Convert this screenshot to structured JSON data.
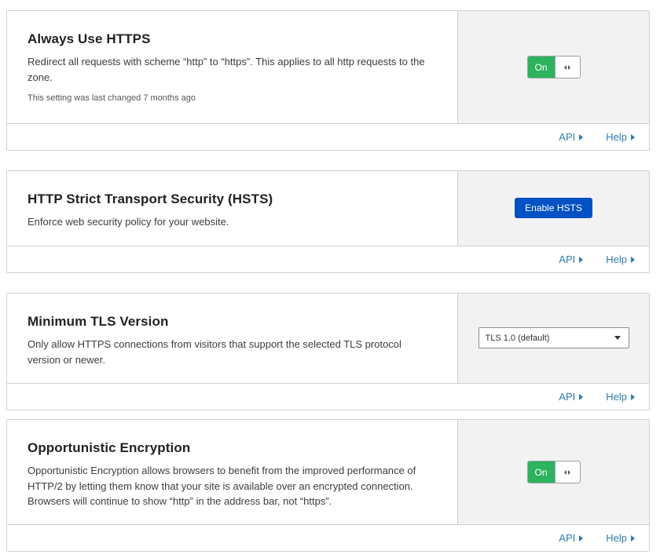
{
  "cards": [
    {
      "title": "Always Use HTTPS",
      "description": "Redirect all requests with scheme “http” to “https”. This applies to all http requests to the zone.",
      "meta": "This setting was last changed 7 months ago",
      "control": {
        "type": "toggle",
        "label": "On",
        "state": "on"
      },
      "api_label": "API",
      "help_label": "Help"
    },
    {
      "title": "HTTP Strict Transport Security (HSTS)",
      "description": "Enforce web security policy for your website.",
      "control": {
        "type": "button",
        "label": "Enable HSTS"
      },
      "api_label": "API",
      "help_label": "Help"
    },
    {
      "title": "Minimum TLS Version",
      "description": "Only allow HTTPS connections from visitors that support the selected TLS protocol version or newer.",
      "control": {
        "type": "select",
        "selected": "TLS 1.0 (default)"
      },
      "api_label": "API",
      "help_label": "Help"
    },
    {
      "title": "Opportunistic Encryption",
      "description": "Opportunistic Encryption allows browsers to benefit from the improved performance of HTTP/2 by letting them know that your site is available over an encrypted connection. Browsers will continue to show “http” in the address bar, not “https”.",
      "control": {
        "type": "toggle",
        "label": "On",
        "state": "on"
      },
      "api_label": "API",
      "help_label": "Help"
    }
  ],
  "colors": {
    "toggle_on": "#2db35d",
    "primary_button": "#0051c3",
    "link": "#2c7cb0",
    "control_panel_bg": "#f2f2f2"
  }
}
